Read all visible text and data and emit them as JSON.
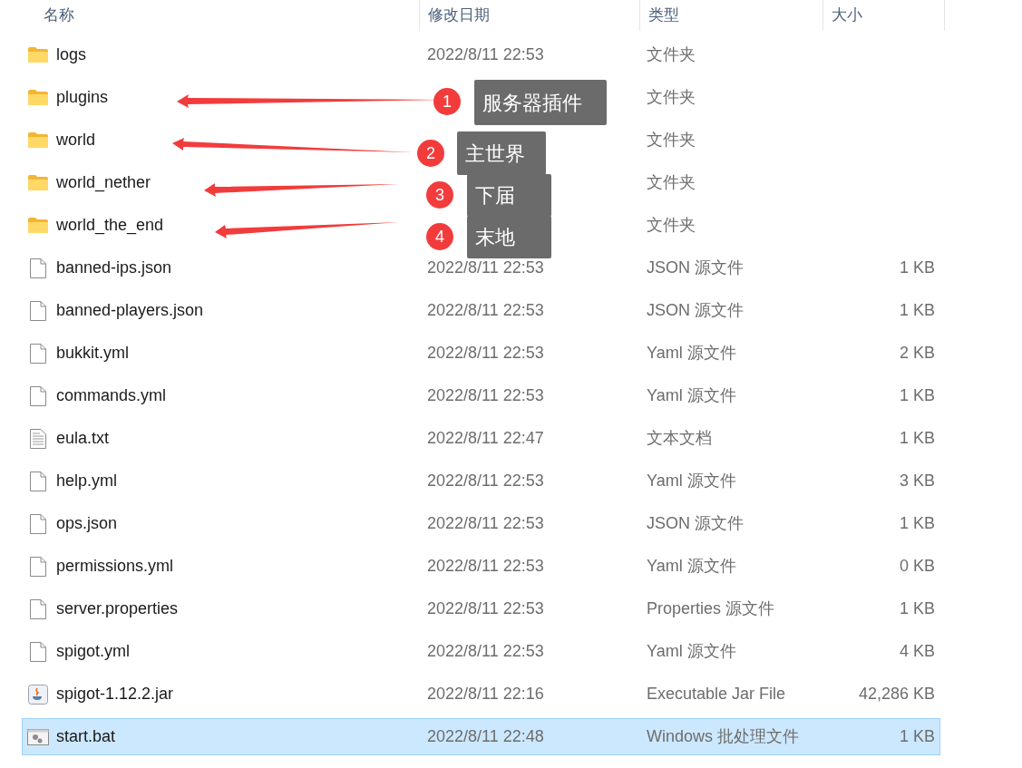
{
  "columns": [
    "名称",
    "修改日期",
    "类型",
    "大小"
  ],
  "rows": [
    {
      "kind": "folder",
      "name": "logs",
      "date": "2022/8/11 22:53",
      "type": "文件夹",
      "selected": false
    },
    {
      "kind": "folder",
      "name": "plugins",
      "type": "文件夹",
      "selected": false
    },
    {
      "kind": "folder",
      "name": "world",
      "type": "文件夹",
      "selected": false
    },
    {
      "kind": "folder",
      "name": "world_nether",
      "type": "文件夹",
      "selected": false
    },
    {
      "kind": "folder",
      "name": "world_the_end",
      "type": "文件夹",
      "selected": false
    },
    {
      "kind": "file",
      "name": "banned-ips.json",
      "date": "2022/8/11 22:53",
      "type": "JSON 源文件",
      "size": "1 KB",
      "selected": false
    },
    {
      "kind": "file",
      "name": "banned-players.json",
      "date": "2022/8/11 22:53",
      "type": "JSON 源文件",
      "size": "1 KB",
      "selected": false
    },
    {
      "kind": "file",
      "name": "bukkit.yml",
      "date": "2022/8/11 22:53",
      "type": "Yaml 源文件",
      "size": "2 KB",
      "selected": false
    },
    {
      "kind": "file",
      "name": "commands.yml",
      "date": "2022/8/11 22:53",
      "type": "Yaml 源文件",
      "size": "1 KB",
      "selected": false
    },
    {
      "kind": "text",
      "name": "eula.txt",
      "date": "2022/8/11 22:47",
      "type": "文本文档",
      "size": "1 KB",
      "selected": false
    },
    {
      "kind": "file",
      "name": "help.yml",
      "date": "2022/8/11 22:53",
      "type": "Yaml 源文件",
      "size": "3 KB",
      "selected": false
    },
    {
      "kind": "file",
      "name": "ops.json",
      "date": "2022/8/11 22:53",
      "type": "JSON 源文件",
      "size": "1 KB",
      "selected": false
    },
    {
      "kind": "file",
      "name": "permissions.yml",
      "date": "2022/8/11 22:53",
      "type": "Yaml 源文件",
      "size": "0 KB",
      "selected": false
    },
    {
      "kind": "file",
      "name": "server.properties",
      "date": "2022/8/11 22:53",
      "type": "Properties 源文件",
      "size": "1 KB",
      "selected": false
    },
    {
      "kind": "file",
      "name": "spigot.yml",
      "date": "2022/8/11 22:53",
      "type": "Yaml 源文件",
      "size": "4 KB",
      "selected": false
    },
    {
      "kind": "jar",
      "name": "spigot-1.12.2.jar",
      "date": "2022/8/11 22:16",
      "type": "Executable Jar File",
      "size": "42,286 KB",
      "selected": false
    },
    {
      "kind": "bat",
      "name": "start.bat",
      "date": "2022/8/11 22:48",
      "type": "Windows 批处理文件",
      "size": "1 KB",
      "selected": true
    }
  ],
  "annotations": [
    {
      "number": "1",
      "label": "服务器插件"
    },
    {
      "number": "2",
      "label": "主世界"
    },
    {
      "number": "3",
      "label": "下届"
    },
    {
      "number": "4",
      "label": "末地"
    }
  ]
}
